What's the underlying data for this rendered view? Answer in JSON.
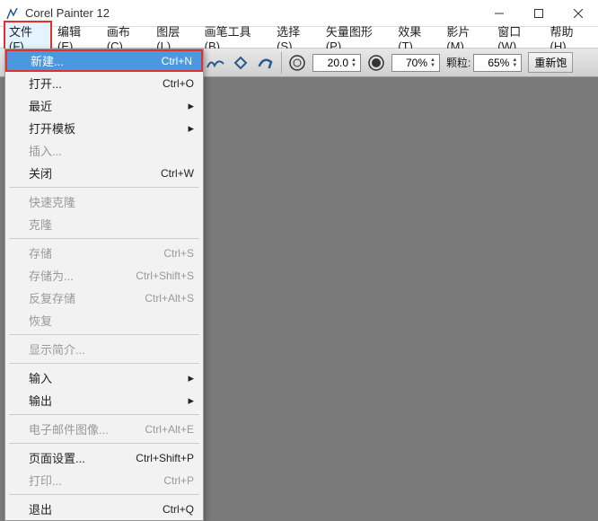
{
  "title": "Corel Painter 12",
  "menubar": [
    {
      "label": "文件(F)"
    },
    {
      "label": "编辑(E)"
    },
    {
      "label": "画布(C)"
    },
    {
      "label": "图层(L)"
    },
    {
      "label": "画笔工具(B)"
    },
    {
      "label": "选择(S)"
    },
    {
      "label": "矢量图形(P)"
    },
    {
      "label": "效果(T)"
    },
    {
      "label": "影片(M)"
    },
    {
      "label": "窗口(W)"
    },
    {
      "label": "帮助(H)"
    }
  ],
  "dropdown": {
    "items": [
      {
        "label": "新建...",
        "shortcut": "Ctrl+N",
        "sel": true,
        "hl": true
      },
      {
        "label": "打开...",
        "shortcut": "Ctrl+O"
      },
      {
        "label": "最近",
        "arrow": true
      },
      {
        "label": "打开模板",
        "arrow": true
      },
      {
        "label": "插入...",
        "disabled": true
      },
      {
        "label": "关闭",
        "shortcut": "Ctrl+W"
      },
      {
        "sep": true
      },
      {
        "label": "快速克隆",
        "disabled": true
      },
      {
        "label": "克隆",
        "disabled": true
      },
      {
        "sep": true
      },
      {
        "label": "存储",
        "shortcut": "Ctrl+S",
        "disabled": true
      },
      {
        "label": "存储为...",
        "shortcut": "Ctrl+Shift+S",
        "disabled": true
      },
      {
        "label": "反复存储",
        "shortcut": "Ctrl+Alt+S",
        "disabled": true
      },
      {
        "label": "恢复",
        "disabled": true
      },
      {
        "sep": true
      },
      {
        "label": "显示简介...",
        "disabled": true
      },
      {
        "sep": true
      },
      {
        "label": "输入",
        "arrow": true
      },
      {
        "label": "输出",
        "arrow": true
      },
      {
        "sep": true
      },
      {
        "label": "电子邮件图像...",
        "shortcut": "Ctrl+Alt+E",
        "disabled": true
      },
      {
        "sep": true
      },
      {
        "label": "页面设置...",
        "shortcut": "Ctrl+Shift+P"
      },
      {
        "label": "打印...",
        "shortcut": "Ctrl+P",
        "disabled": true
      },
      {
        "sep": true
      },
      {
        "label": "退出",
        "shortcut": "Ctrl+Q"
      }
    ]
  },
  "toolbar": {
    "size_value": "20.0",
    "opacity_value": "70%",
    "grain_label": "颗粒:",
    "grain_value": "65%",
    "resat_btn": "重新饱"
  }
}
